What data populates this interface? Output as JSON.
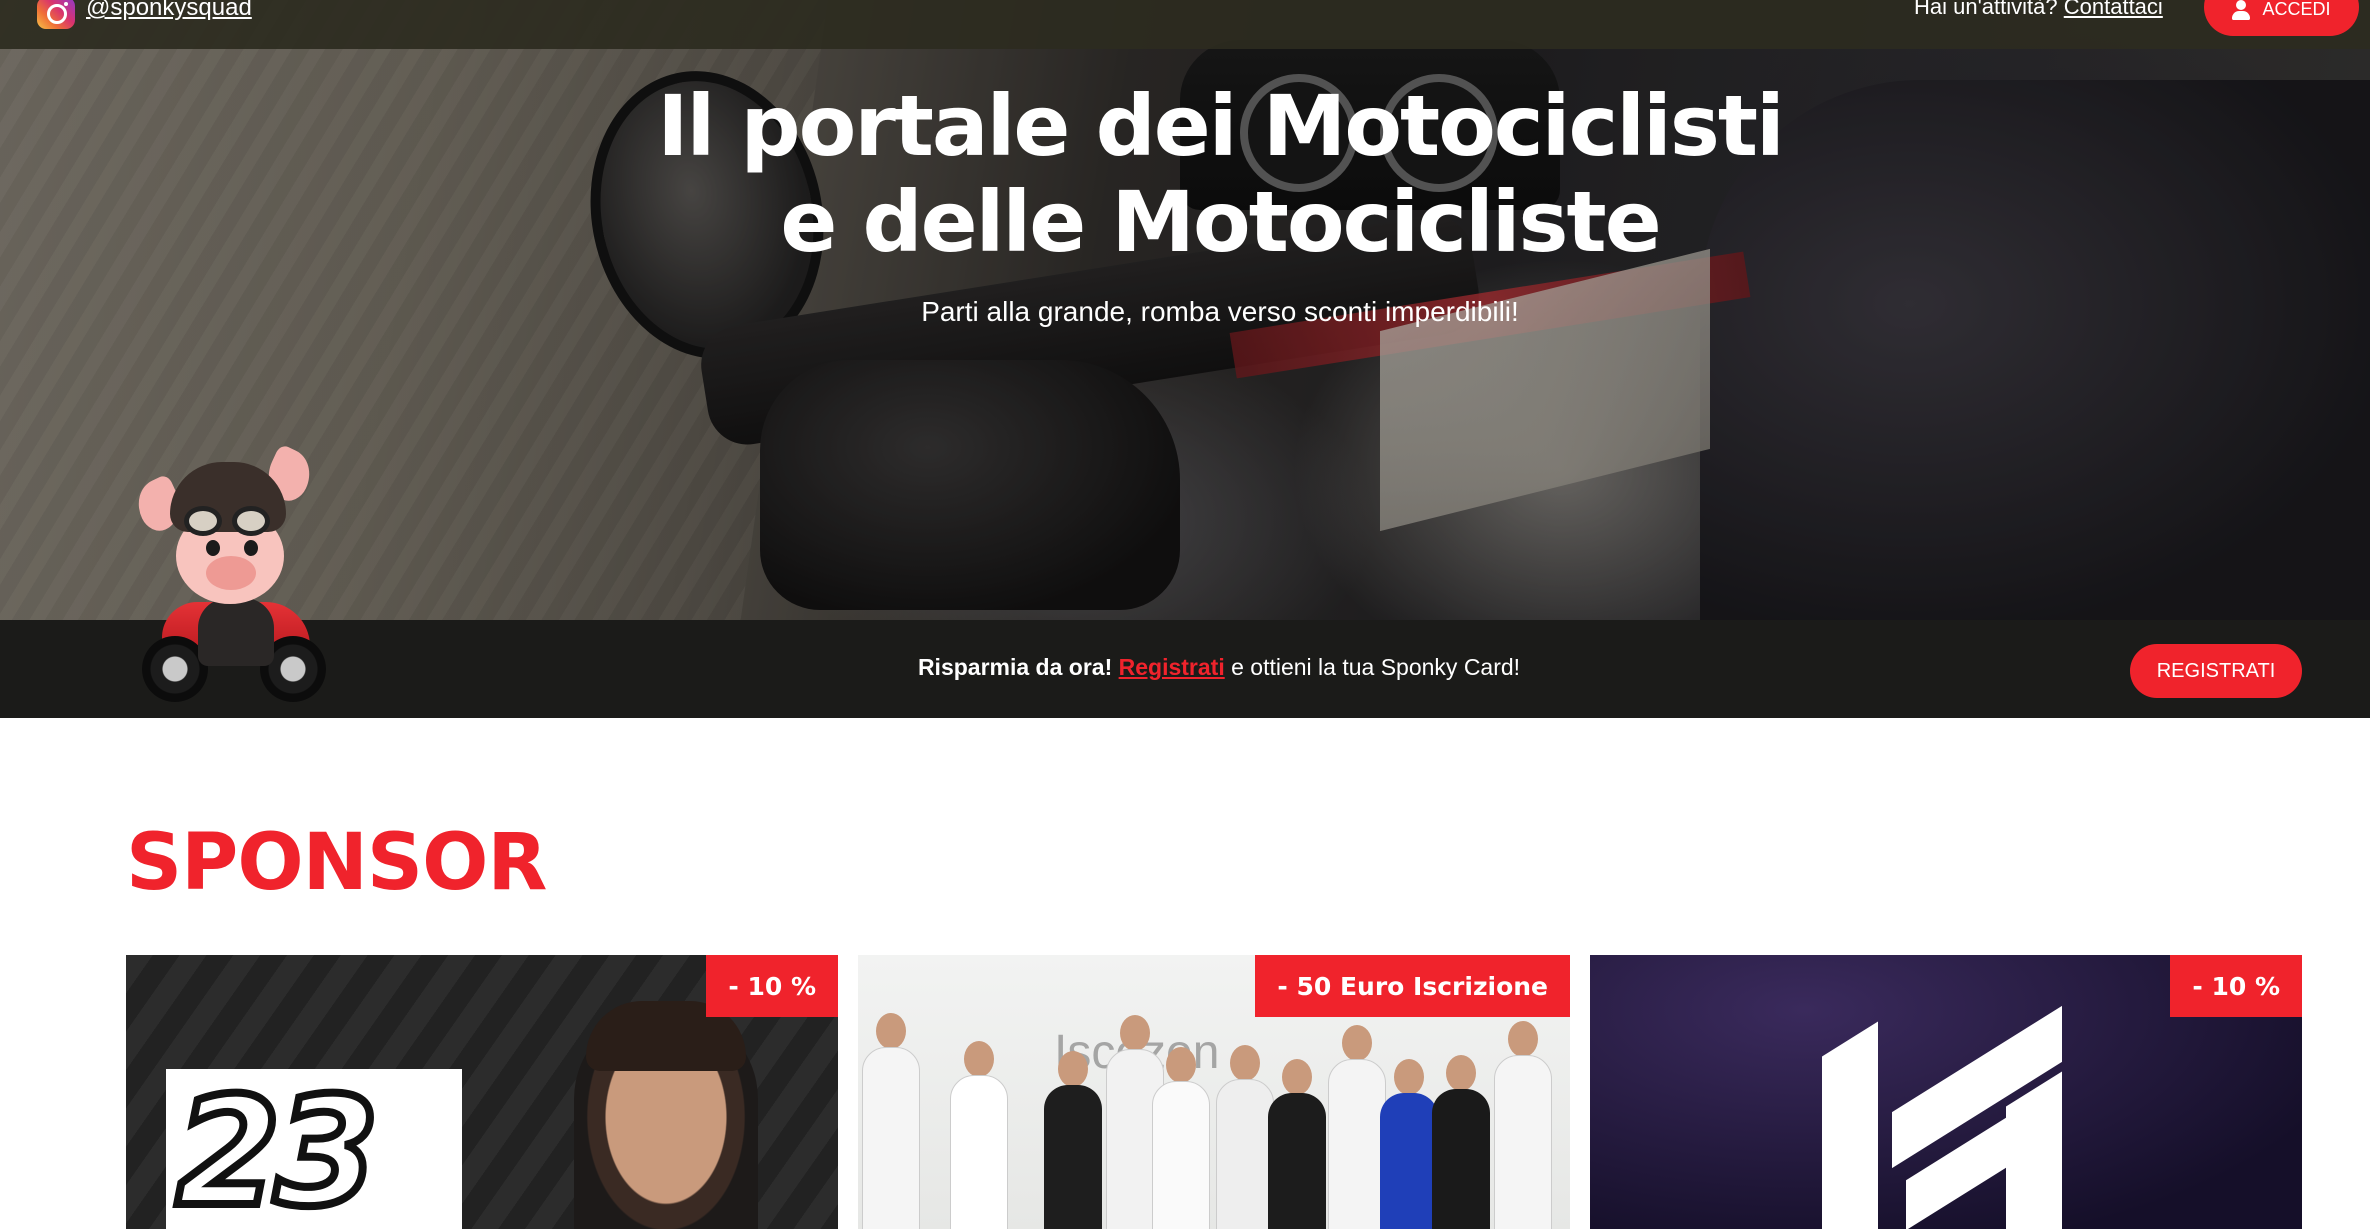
{
  "topbar": {
    "instagram_handle": "@sponkysquad",
    "business_question": "Hai un'attività?",
    "business_link": "Contattaci",
    "login_label": "ACCEDI"
  },
  "hero": {
    "title_line1": "Il portale dei Motociclisti",
    "title_line2": "e delle Motocicliste",
    "subtitle": "Parti alla grande, romba verso sconti imperdibili!"
  },
  "promo": {
    "strong_text": "Risparmia da ora!",
    "link_text": "Registrati",
    "rest_text": " e ottieni la tua Sponky Card!",
    "register_label": "REGISTRATI"
  },
  "sponsor": {
    "heading": "SPONSOR",
    "cards": [
      {
        "badge": "- 10 %",
        "logo_text": "23"
      },
      {
        "badge": "- 50 Euro Iscrizione",
        "wall_text": "Iscozen"
      },
      {
        "badge": "- 10 %"
      }
    ]
  },
  "colors": {
    "accent": "#f0232c",
    "topbar": "#2d2b20",
    "promo_strip": "#1b1b19"
  },
  "icons": [
    "instagram-icon",
    "user-icon",
    "mascot-pig-biker"
  ]
}
